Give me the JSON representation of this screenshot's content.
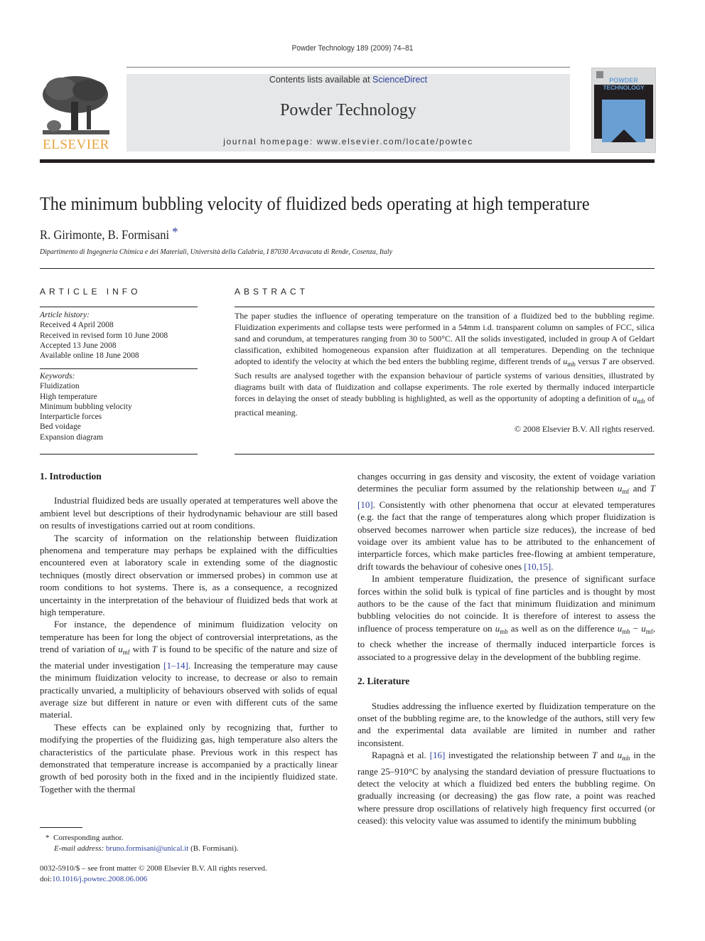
{
  "running_head": "Powder Technology 189 (2009) 74–81",
  "masthead": {
    "contents_prefix": "Contents lists available at ",
    "contents_link": "ScienceDirect",
    "journal_title": "Powder Technology",
    "homepage": "journal homepage: www.elsevier.com/locate/powtec",
    "publisher_logo_text": "ELSEVIER",
    "cover": {
      "line1": "POWDER",
      "line2": "TECHNOLOGY",
      "accent_color": "#6a9fd4",
      "dark_color": "#231f20"
    },
    "logo_color": "#e7a33b"
  },
  "article": {
    "title": "The minimum bubbling velocity of fluidized beds operating at high temperature",
    "authors": "R. Girimonte, B. Formisani",
    "corresponding_mark": "*",
    "affiliation": "Dipartimento di Ingegneria Chimica e dei Materiali, Università della Calabria, I 87030 Arcavacata di Rende, Cosenza, Italy"
  },
  "article_info": {
    "heading": "ARTICLE INFO",
    "history_label": "Article history:",
    "history": [
      "Received 4 April 2008",
      "Received in revised form 10 June 2008",
      "Accepted 13 June 2008",
      "Available online 18 June 2008"
    ],
    "keywords_label": "Keywords:",
    "keywords": [
      "Fluidization",
      "High temperature",
      "Minimum bubbling velocity",
      "Interparticle forces",
      "Bed voidage",
      "Expansion diagram"
    ]
  },
  "abstract": {
    "heading": "ABSTRACT",
    "text_1": "The paper studies the influence of operating temperature on the transition of a fluidized bed to the bubbling regime. Fluidization experiments and collapse tests were performed in a 54mm i.d. transparent column on samples of FCC, silica sand and corundum, at temperatures ranging from 30 to 500°C. All the solids investigated, included in group A of Geldart classification, exhibited homogeneous expansion after fluidization at all temperatures. Depending on the technique adopted to identify the velocity at which the bed enters the bubbling regime, different trends of ",
    "u": "u",
    "mb": "mb",
    "text_2": " versus ",
    "T": "T",
    "text_3": " are observed. Such results are analysed together with the expansion behaviour of particle systems of various densities, illustrated by diagrams built with data of fluidization and collapse experiments. The role exerted by thermally induced interparticle forces in delaying the onset of steady bubbling is highlighted, as well as the opportunity of adopting a definition of ",
    "text_4": " of practical meaning.",
    "copyright": "© 2008 Elsevier B.V. All rights reserved."
  },
  "body": {
    "intro_heading": "1. Introduction",
    "p1": "Industrial fluidized beds are usually operated at temperatures well above the ambient level but descriptions of their hydrodynamic behaviour are still based on results of investigations carried out at room conditions.",
    "p2": "The scarcity of information on the relationship between fluidization phenomena and temperature may perhaps be explained with the difficulties encountered even at laboratory scale in extending some of the diagnostic techniques (mostly direct observation or immersed probes) in common use at room conditions to hot systems. There is, as a consequence, a recognized uncertainty in the interpretation of the behaviour of fluidized beds that work at high temperature.",
    "p3a": "For instance, the dependence of minimum fluidization velocity on temperature has been for long the object of controversial interpretations, as the trend of variation of ",
    "mf": "mf",
    "p3b": " with ",
    "p3c": " is found to be specific of the nature and size of the material under investigation ",
    "ref_1_14": "[1–14]",
    "p3d": ". Increasing the temperature may cause the minimum fluidization velocity to increase, to decrease or also to remain practically unvaried, a multiplicity of behaviours observed with solids of equal average size but different in nature or even with different cuts of the same material.",
    "p4": "These effects can be explained only by recognizing that, further to modifying the properties of the fluidizing gas, high temperature also alters the characteristics of the particulate phase. Previous work in this respect has demonstrated that temperature increase is accompanied by a practically linear growth of bed porosity both in the fixed and in the incipiently fluidized state. Together with the thermal",
    "r1a": "changes occurring in gas density and viscosity, the extent of voidage variation determines the peculiar form assumed by the relationship between ",
    "r1b": " and ",
    "ref_10": "[10]",
    "r1c": ". Consistently with other phenomena that occur at elevated temperatures (e.g. the fact that the range of temperatures along which proper fluidization is observed becomes narrower when particle size reduces), the increase of bed voidage over its ambient value has to be attributed to the enhancement of interparticle forces, which make particles free-flowing at ambient temperature, drift towards the behaviour of cohesive ones ",
    "ref_10_15": "[10,15]",
    "r2a": "In ambient temperature fluidization, the presence of significant surface forces within the solid bulk is typical of fine particles and is thought by most authors to be the cause of the fact that minimum fluidization and minimum bubbling velocities do not coincide. It is therefore of interest to assess the influence of process temperature on ",
    "r2b": " as well as on the difference ",
    "minus": " − ",
    "r2c": ", to check whether the increase of thermally induced interparticle forces is associated to a progressive delay in the development of the bubbling regime.",
    "lit_heading": "2. Literature",
    "r3": "Studies addressing the influence exerted by fluidization temperature on the onset of the bubbling regime are, to the knowledge of the authors, still very few and the experimental data available are limited in number and rather inconsistent.",
    "r4a": "Rapagnà et al. ",
    "ref_16": "[16]",
    "r4b": " investigated the relationship between ",
    "r4c": " and ",
    "r4d": " in the range 25–910°C by analysing the standard deviation of pressure fluctuations to detect the velocity at which a fluidized bed enters the bubbling regime. On gradually increasing (or decreasing) the gas flow rate, a point was reached where pressure drop oscillations of relatively high frequency first occurred (or ceased): this velocity value was assumed to identify the minimum bubbling"
  },
  "footnote": {
    "mark": "*",
    "corresponding": "Corresponding author.",
    "email_label": "E-mail address:",
    "email": "bruno.formisani@unical.it",
    "email_owner": "(B. Formisani)."
  },
  "front_matter": {
    "issn_line": "0032-5910/$ – see front matter © 2008 Elsevier B.V. All rights reserved.",
    "doi_label": "doi:",
    "doi": "10.1016/j.powtec.2008.06.006"
  }
}
